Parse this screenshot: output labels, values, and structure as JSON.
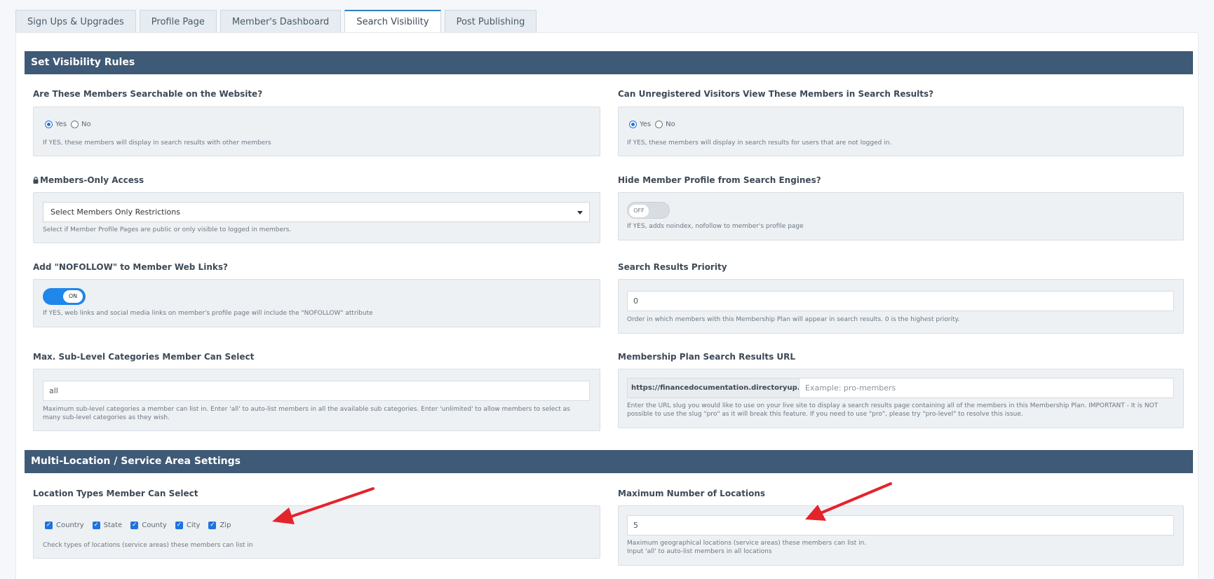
{
  "tabs": [
    {
      "label": "Sign Ups & Upgrades"
    },
    {
      "label": "Profile Page"
    },
    {
      "label": "Member's Dashboard"
    },
    {
      "label": "Search Visibility",
      "active": true
    },
    {
      "label": "Post Publishing"
    }
  ],
  "sections": {
    "visibility": "Set Visibility Rules",
    "multi_location": "Multi-Location / Service Area Settings"
  },
  "searchable": {
    "label": "Are These Members Searchable on the Website?",
    "yes": "Yes",
    "no": "No",
    "selected": "Yes",
    "help": "If YES, these members will display in search results with other members"
  },
  "unregistered": {
    "label": "Can Unregistered Visitors View These Members in Search Results?",
    "yes": "Yes",
    "no": "No",
    "selected": "Yes",
    "help": "If YES, these members will display in search results for users that are not logged in."
  },
  "members_only": {
    "label": "Members-Only Access",
    "select_value": "Select Members Only Restrictions",
    "help": "Select if Member Profile Pages are public or only visible to logged in members."
  },
  "hide_profile": {
    "label": "Hide Member Profile from Search Engines?",
    "toggle": "OFF",
    "help": "If YES, adds noindex, nofollow to member's profile page"
  },
  "nofollow": {
    "label": "Add \"NOFOLLOW\" to Member Web Links?",
    "toggle": "ON",
    "help": "If YES, web links and social media links on member's profile page will include the \"NOFOLLOW\" attribute"
  },
  "priority": {
    "label": "Search Results Priority",
    "value": "0",
    "help": "Order in which members with this Membership Plan will appear in search results. 0 is the highest priority."
  },
  "max_sub": {
    "label": "Max. Sub-Level Categories Member Can Select",
    "value": "all",
    "help": "Maximum sub-level categories a member can list in. Enter 'all' to auto-list members in all the available sub categories. Enter 'unlimited' to allow members to select as many sub-level categories as they wish."
  },
  "plan_url": {
    "label": "Membership Plan Search Results URL",
    "prefix": "https://financedocumentation.directoryup.com/",
    "placeholder": "Example: pro-members",
    "help": "Enter the URL slug you would like to use on your live site to display a search results page containing all of the members in this Membership Plan. IMPORTANT - It is NOT possible to use the slug \"pro\" as it will break this feature. If you need to use \"pro\", please try \"pro-level\" to resolve this issue."
  },
  "location_types": {
    "label": "Location Types Member Can Select",
    "options": [
      "Country",
      "State",
      "County",
      "City",
      "Zip"
    ],
    "help": "Check types of locations (service areas) these members can list in"
  },
  "max_locations": {
    "label": "Maximum Number of Locations",
    "value": "5",
    "help_line1": "Maximum geographical locations (service areas) these members can list in.",
    "help_line2": "Input 'all' to auto-list members in all locations"
  },
  "colors": {
    "section_bar": "#3f5a76",
    "accent": "#1f86ea",
    "annotation_arrow": "#e5232b"
  }
}
